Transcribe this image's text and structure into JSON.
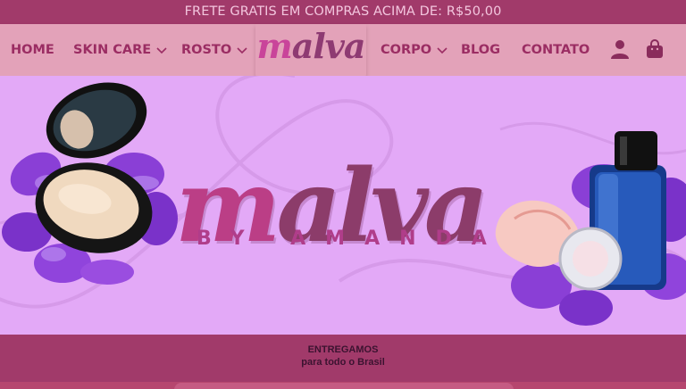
{
  "promo_bar": {
    "text": "FRETE GRATIS EM COMPRAS ACIMA DE: R$50,00"
  },
  "nav": {
    "items": [
      {
        "label": "HOME",
        "has_dropdown": false
      },
      {
        "label": "SKIN CARE",
        "has_dropdown": true
      },
      {
        "label": "ROSTO",
        "has_dropdown": true
      },
      {
        "label": "CORPO",
        "has_dropdown": true
      },
      {
        "label": "BLOG",
        "has_dropdown": false
      },
      {
        "label": "CONTATO",
        "has_dropdown": false
      }
    ],
    "logo_prefix": "m",
    "logo_rest": "alva",
    "icons": [
      "user-icon",
      "shopping-bag-icon"
    ]
  },
  "hero": {
    "brand_prefix": "m",
    "brand_rest": "alva",
    "byline": "BY AMANDA",
    "images": [
      "compact-powder",
      "perfume-bottle",
      "violet-flowers"
    ]
  },
  "shipping_strip": {
    "title": "ENTREGAMOS",
    "subtitle": "para todo o Brasil"
  },
  "colors": {
    "promo_bg": "#a13a6a",
    "nav_bg": "#e3a2b9",
    "nav_text": "#9b2d63",
    "hero_bg": "#e3a9f7",
    "brand_plum": "#8c3c6a",
    "brand_magenta": "#bb3e86"
  }
}
